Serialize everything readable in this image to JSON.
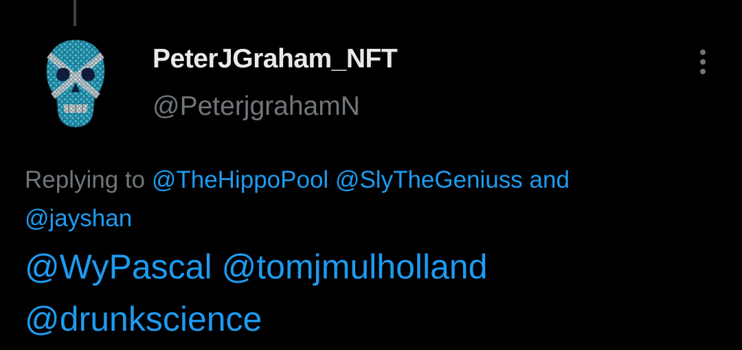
{
  "tweet": {
    "display_name": "PeterJGraham_NFT",
    "handle": "@PeterjgrahamN",
    "avatar_icon": "mosaic-skull-avatar",
    "more_icon": "more-vertical-icon",
    "replying_prefix": "Replying to",
    "replying_mentions": [
      "@TheHippoPool",
      "@SlyTheGeniuss"
    ],
    "replying_conjunction": "and",
    "replying_last_mention": "@jayshan",
    "body_mentions": [
      "@WyPascal",
      "@tomjmulholland",
      "@drunkscience"
    ]
  },
  "colors": {
    "background": "#000000",
    "primary_text": "#e7e9ea",
    "secondary_text": "#71767b",
    "link": "#1d9bf0",
    "thread_line": "#3e4144"
  }
}
